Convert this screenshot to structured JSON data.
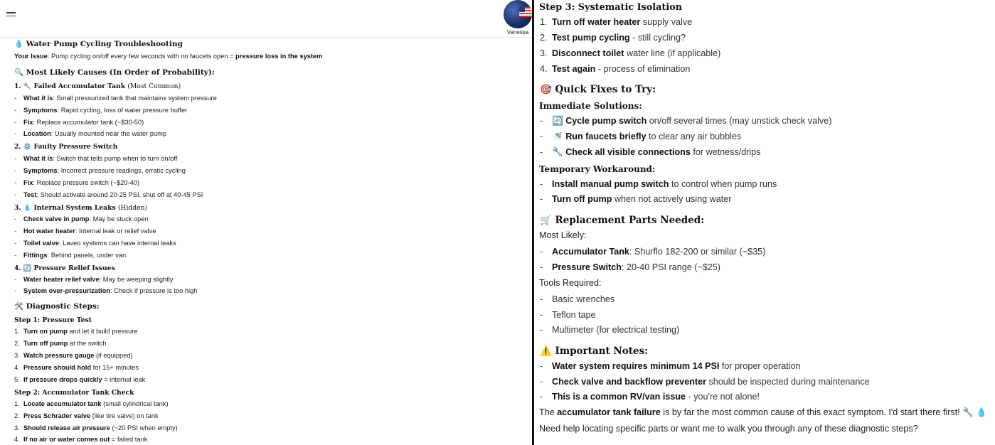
{
  "header": {
    "user_name": "Vanessa"
  },
  "left": {
    "title": "Water Pump Cycling Troubleshooting",
    "title_emoji": "💧",
    "issue": {
      "label": "Your Issue",
      "text": ": Pump cycling on/off every few seconds with no faucets open = ",
      "bold_end": "pressure loss in the system"
    },
    "causes": {
      "heading": "Most Likely Causes (In Order of Probability):",
      "emoji": "🔍",
      "groups": [
        {
          "num": "1.",
          "emoji": "🔧",
          "title": "Failed Accumulator Tank",
          "title_note": "(Most Common)",
          "items": [
            {
              "b": "What it is",
              "t": ": Small pressurized tank that maintains system pressure"
            },
            {
              "b": "Symptoms",
              "t": ": Rapid cycling, loss of water pressure buffer"
            },
            {
              "b": "Fix",
              "t": ": Replace accumulator tank (~$30-50)"
            },
            {
              "b": "Location",
              "t": ": Usually mounted near the water pump"
            }
          ]
        },
        {
          "num": "2.",
          "emoji": "⚙️",
          "title": "Faulty Pressure Switch",
          "title_note": "",
          "items": [
            {
              "b": "What it is",
              "t": ": Switch that tells pump when to turn on/off"
            },
            {
              "b": "Symptoms",
              "t": ": Incorrect pressure readings, erratic cycling"
            },
            {
              "b": "Fix",
              "t": ": Replace pressure switch (~$20-40)"
            },
            {
              "b": "Test",
              "t": ": Should activate around 20-25 PSI, shut off at 40-45 PSI"
            }
          ]
        },
        {
          "num": "3.",
          "emoji": "💧",
          "title": "Internal System Leaks",
          "title_note": "(Hidden)",
          "items": [
            {
              "b": "Check valve in pump",
              "t": ": May be stuck open"
            },
            {
              "b": "Hot water heater",
              "t": ": Internal leak or relief valve"
            },
            {
              "b": "Toilet valve",
              "t": ": Laveo systems can have internal leaks"
            },
            {
              "b": "Fittings",
              "t": ": Behind panels, under van"
            }
          ]
        },
        {
          "num": "4.",
          "emoji": "🔄",
          "title": "Pressure Relief Issues",
          "title_note": "",
          "items": [
            {
              "b": "Water heater relief valve",
              "t": ": May be weeping slightly"
            },
            {
              "b": "System over-pressurization",
              "t": ": Check if pressure is too high"
            }
          ]
        }
      ]
    },
    "diagnostic": {
      "heading": "Diagnostic Steps:",
      "emoji": "🛠️",
      "step1": {
        "title": "Step 1: Pressure Test",
        "items": [
          {
            "n": "1.",
            "b": "Turn on pump",
            "t": " and let it build pressure"
          },
          {
            "n": "2.",
            "b": "Turn off pump",
            "t": " at the switch"
          },
          {
            "n": "3.",
            "b": "Watch pressure gauge",
            "t": " (if equipped)"
          },
          {
            "n": "4.",
            "b": "Pressure should hold",
            "t": " for 15+ minutes"
          },
          {
            "n": "5.",
            "b": "If pressure drops quickly",
            "t": " = internal leak"
          }
        ]
      },
      "step2": {
        "title": "Step 2: Accumulator Tank Check",
        "items": [
          {
            "n": "1.",
            "b": "Locate accumulator tank",
            "t": " (small cylindrical tank)"
          },
          {
            "n": "2.",
            "b": "Press Schrader valve",
            "t": " (like tire valve) on tank"
          },
          {
            "n": "3.",
            "b": "Should release air pressure",
            "t": " (~20 PSI when empty)"
          },
          {
            "n": "4.",
            "b": "If no air or water comes out",
            "t": " = failed tank"
          }
        ]
      }
    }
  },
  "right": {
    "step3": {
      "title": "Step 3: Systematic Isolation",
      "items": [
        {
          "n": "1.",
          "b": "Turn off water heater",
          "t": " supply valve"
        },
        {
          "n": "2.",
          "b": "Test pump cycling",
          "t": " - still cycling?"
        },
        {
          "n": "3.",
          "b": "Disconnect toilet",
          "t": " water line (if applicable)"
        },
        {
          "n": "4.",
          "b": "Test again",
          "t": " - process of elimination"
        }
      ]
    },
    "quick_fixes": {
      "heading": "Quick Fixes to Try:",
      "emoji": "🎯",
      "immediate_title": "Immediate Solutions:",
      "immediate": [
        {
          "e": "🔄",
          "b": "Cycle pump switch",
          "t": " on/off several times (may unstick check valve)"
        },
        {
          "e": "🚿",
          "b": "Run faucets briefly",
          "t": " to clear any air bubbles"
        },
        {
          "e": "🔧",
          "b": "Check all visible connections",
          "t": " for wetness/drips"
        }
      ],
      "temporary_title": "Temporary Workaround:",
      "temporary": [
        {
          "b": "Install manual pump switch",
          "t": " to control when pump runs"
        },
        {
          "b": "Turn off pump",
          "t": " when not actively using water"
        }
      ]
    },
    "parts": {
      "heading": "Replacement Parts Needed:",
      "emoji": "🛒",
      "most_likely_label": "Most Likely:",
      "most_likely": [
        {
          "b": "Accumulator Tank",
          "t": ": Shurflo 182-200 or similar (~$35)"
        },
        {
          "b": "Pressure Switch",
          "t": ": 20-40 PSI range (~$25)"
        }
      ],
      "tools_label": "Tools Required:",
      "tools": [
        "Basic wrenches",
        "Teflon tape",
        "Multimeter (for electrical testing)"
      ]
    },
    "notes": {
      "heading": "Important Notes:",
      "emoji": "⚠️",
      "items": [
        {
          "b": "Water system requires minimum 14 PSI",
          "t": " for proper operation"
        },
        {
          "b": "Check valve and backflow preventer",
          "t": " should be inspected during maintenance"
        },
        {
          "b": "This is a common RV/van issue",
          "t": " - you're not alone!"
        }
      ]
    },
    "closing": {
      "pre": "The ",
      "b": "accumulator tank failure",
      "post": " is by far the most common cause of this exact symptom. I'd start there first! ",
      "emoji": "🔧 💧"
    },
    "followup": "Need help locating specific parts or want me to walk you through any of these diagnostic steps?"
  }
}
